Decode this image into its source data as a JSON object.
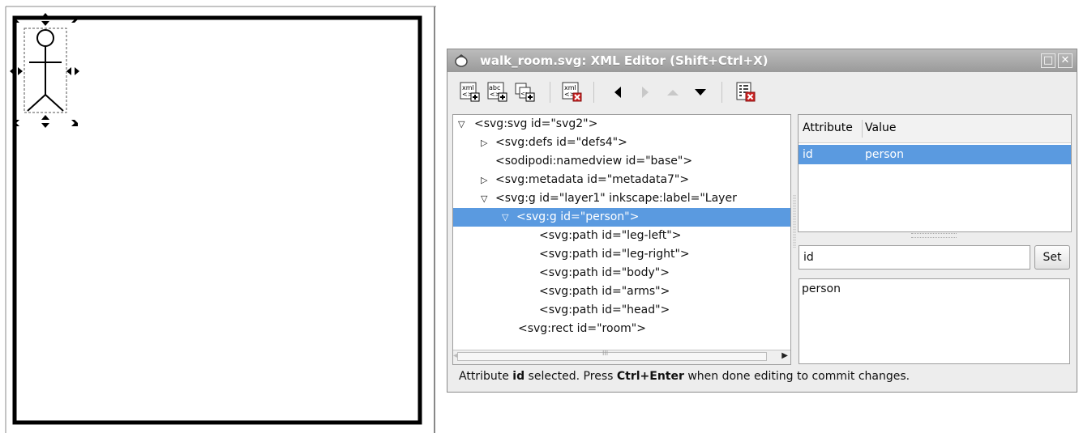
{
  "window": {
    "title": "walk_room.svg: XML Editor (Shift+Ctrl+X)",
    "maximize_glyph": "□",
    "close_glyph": "✕"
  },
  "toolbar": {
    "new_element_text": "xml",
    "new_text_node_text": "abc",
    "delete_node_text": "xml",
    "buttons": [
      "new-element-node",
      "new-text-node",
      "duplicate-node",
      "delete-node",
      "unindent-node",
      "indent-node",
      "raise-node",
      "lower-node",
      "delete-attribute"
    ]
  },
  "tree": {
    "nodes": [
      {
        "text": "<svg:svg id=\"svg2\">",
        "expander": "▽"
      },
      {
        "text": "<svg:defs id=\"defs4\">",
        "expander": "▷"
      },
      {
        "text": "<sodipodi:namedview id=\"base\">",
        "expander": ""
      },
      {
        "text": "<svg:metadata id=\"metadata7\">",
        "expander": "▷"
      },
      {
        "text": "<svg:g id=\"layer1\" inkscape:label=\"Layer",
        "expander": "▽"
      },
      {
        "text": "<svg:g id=\"person\">",
        "expander": "▽",
        "selected": true
      },
      {
        "text": "<svg:path id=\"leg-left\">",
        "expander": ""
      },
      {
        "text": "<svg:path id=\"leg-right\">",
        "expander": ""
      },
      {
        "text": "<svg:path id=\"body\">",
        "expander": ""
      },
      {
        "text": "<svg:path id=\"arms\">",
        "expander": ""
      },
      {
        "text": "<svg:path id=\"head\">",
        "expander": ""
      },
      {
        "text": "<svg:rect id=\"room\">",
        "expander": ""
      }
    ],
    "scroll_mid_glyph": "III"
  },
  "attributes": {
    "header_attribute": "Attribute",
    "header_value": "Value",
    "rows": [
      {
        "name": "id",
        "value": "person"
      }
    ],
    "name_field_value": "id",
    "set_label": "Set",
    "value_text": "person"
  },
  "status": {
    "part1": "Attribute ",
    "attr": "id",
    "part2": " selected. Press ",
    "keys": "Ctrl+Enter",
    "part3": " when done editing to commit changes."
  },
  "colors": {
    "selection": "#5a9ae0",
    "titlebar": "#a8a8a8",
    "delete_red": "#cc2222"
  }
}
